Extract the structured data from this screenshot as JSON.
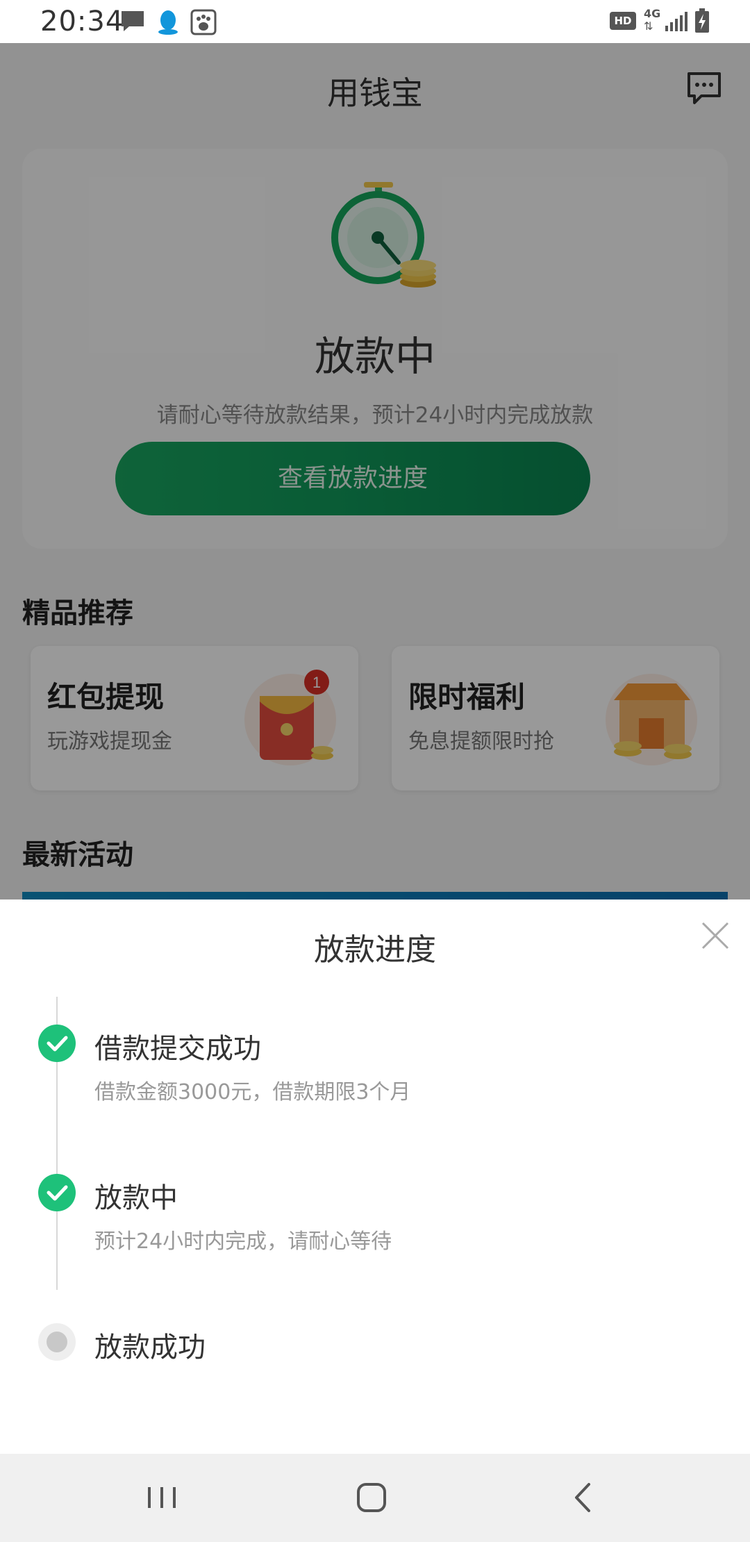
{
  "status_bar": {
    "time": "20:34",
    "left_icons": [
      "message-icon",
      "qq-icon",
      "baidu-icon"
    ],
    "hd": "HD",
    "network": "4G",
    "right_icons": [
      "signal-icon",
      "battery-charging-icon"
    ]
  },
  "header": {
    "title": "用钱宝",
    "message_icon": "chat-bubble-icon"
  },
  "status_card": {
    "illustration": "stopwatch-coins-icon",
    "title": "放款中",
    "subtitle": "请耐心等待放款结果，预计24小时内完成放款",
    "button_label": "查看放款进度"
  },
  "recommend": {
    "section_title": "精品推荐",
    "items": [
      {
        "title": "红包提现",
        "subtitle": "玩游戏提现金",
        "icon": "red-envelope-icon",
        "badge": "1"
      },
      {
        "title": "限时福利",
        "subtitle": "免息提额限时抢",
        "icon": "shop-coins-icon"
      }
    ]
  },
  "activities": {
    "section_title": "最新活动"
  },
  "sheet": {
    "title": "放款进度",
    "close_icon": "close-icon",
    "steps": [
      {
        "title": "借款提交成功",
        "desc": "借款金额3000元，借款期限3个月",
        "state": "done"
      },
      {
        "title": "放款中",
        "desc": "预计24小时内完成，请耐心等待",
        "state": "done"
      },
      {
        "title": "放款成功",
        "desc": "",
        "state": "pending"
      }
    ]
  },
  "colors": {
    "accent": "#19a560",
    "check": "#1ec17a",
    "pending_dot": "#c8c8c8"
  },
  "nav_bar": {
    "icons": [
      "recents-icon",
      "home-icon",
      "back-icon"
    ]
  }
}
